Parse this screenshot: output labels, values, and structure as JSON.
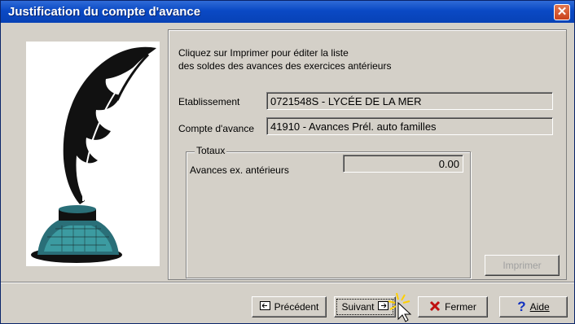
{
  "window": {
    "title": "Justification du compte d'avance",
    "close_glyph": "✕"
  },
  "instructions": {
    "line1": "Cliquez sur Imprimer pour éditer la liste",
    "line2": " des soldes des avances des exercices antérieurs"
  },
  "fields": {
    "etablissement_label": "Etablissement",
    "etablissement_value": "0721548S - LYCÉE DE LA MER",
    "compte_label": "Compte d'avance",
    "compte_value": "41910 - Avances Prél. auto familles"
  },
  "totaux": {
    "title": "Totaux",
    "avances_label": "Avances ex. antérieurs",
    "avances_value": "0.00"
  },
  "buttons": {
    "imprimer": "Imprimer",
    "precedent": "Précédent",
    "suivant": "Suivant",
    "fermer": "Fermer",
    "aide": "Aide"
  },
  "icons": {
    "precedent": "navigate-left-icon",
    "suivant": "navigate-right-icon",
    "fermer": "close-x-icon",
    "aide": "help-question-icon",
    "illustration": "quill-inkwell-icon"
  },
  "colors": {
    "title_bar": "#0a49c4",
    "close_button": "#c9411b",
    "fermer_icon": "#c01010",
    "aide_icon": "#1030c0",
    "highlight_glow": "#ffd000"
  }
}
